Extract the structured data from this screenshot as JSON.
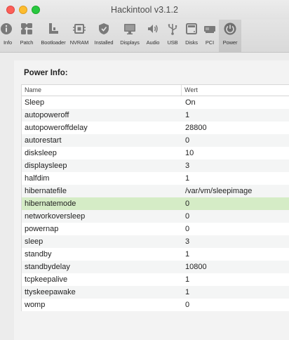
{
  "window": {
    "title": "Hackintool v3.1.2"
  },
  "toolbar": {
    "items": [
      {
        "label": "Info",
        "icon": "info-icon"
      },
      {
        "label": "Patch",
        "icon": "puzzle-icon"
      },
      {
        "label": "Bootloader",
        "icon": "bootloader-icon"
      },
      {
        "label": "NVRAM",
        "icon": "chip-icon"
      },
      {
        "label": "Installed",
        "icon": "shield-icon"
      },
      {
        "label": "Displays",
        "icon": "monitor-icon"
      },
      {
        "label": "Audio",
        "icon": "speaker-icon"
      },
      {
        "label": "USB",
        "icon": "usb-icon"
      },
      {
        "label": "Disks",
        "icon": "disk-icon"
      },
      {
        "label": "PCI",
        "icon": "pci-icon"
      },
      {
        "label": "Power",
        "icon": "power-icon"
      }
    ],
    "active": "Power"
  },
  "power": {
    "section_title": "Power Info:",
    "columns": {
      "name": "Name",
      "value": "Wert"
    },
    "rows": [
      {
        "name": "Sleep",
        "value": "On"
      },
      {
        "name": "autopoweroff",
        "value": "1"
      },
      {
        "name": "autopoweroffdelay",
        "value": "28800"
      },
      {
        "name": "autorestart",
        "value": "0"
      },
      {
        "name": "disksleep",
        "value": "10"
      },
      {
        "name": "displaysleep",
        "value": "3"
      },
      {
        "name": "halfdim",
        "value": "1"
      },
      {
        "name": "hibernatefile",
        "value": "/var/vm/sleepimage"
      },
      {
        "name": "hibernatemode",
        "value": "0",
        "selected": true
      },
      {
        "name": "networkoversleep",
        "value": "0"
      },
      {
        "name": "powernap",
        "value": "0"
      },
      {
        "name": "sleep",
        "value": "3"
      },
      {
        "name": "standby",
        "value": "1"
      },
      {
        "name": "standbydelay",
        "value": "10800"
      },
      {
        "name": "tcpkeepalive",
        "value": "1"
      },
      {
        "name": "ttyskeepawake",
        "value": "1"
      },
      {
        "name": "womp",
        "value": "0"
      }
    ]
  },
  "colors": {
    "selected_row": "#d5ecc6",
    "close": "#fc5f57",
    "minimize": "#fdbc2e",
    "zoom": "#28c840"
  }
}
